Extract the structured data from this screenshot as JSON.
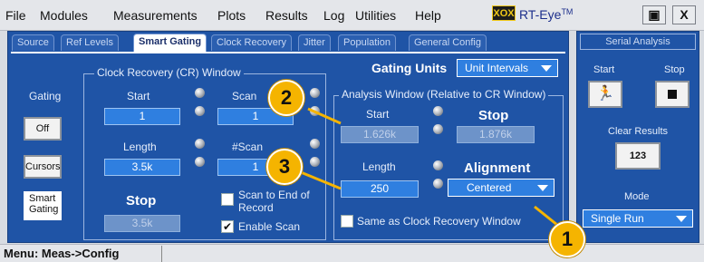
{
  "menu": {
    "items": [
      "File",
      "Modules",
      "Measurements",
      "Plots",
      "Results",
      "Log",
      "Utilities",
      "Help"
    ],
    "brand_logo": "XOX",
    "brand_name": "RT-Eye",
    "brand_tm": "TM",
    "restore_glyph": "▣",
    "close_glyph": "X"
  },
  "tabs": [
    "Source",
    "Ref Levels",
    "Smart Gating",
    "Clock Recovery",
    "Jitter",
    "Population",
    "General Config"
  ],
  "active_tab": "Smart Gating",
  "gating": {
    "label": "Gating",
    "off_button": "Off",
    "cursors_button": "Cursors",
    "smart_gating_button": "Smart Gating"
  },
  "cr_window": {
    "title": "Clock Recovery (CR) Window",
    "start_label": "Start",
    "start_value": "1",
    "length_label": "Length",
    "length_value": "3.5k",
    "stop_label": "Stop",
    "stop_value": "3.5k",
    "scan_label": "Scan",
    "scan_value": "1",
    "nscans_label": "#Scan",
    "nscans_value": "1",
    "scan_to_end_label": "Scan to End of Record",
    "enable_scan_label": "Enable Scan",
    "enable_scan_checked": "✔"
  },
  "gating_units": {
    "label": "Gating Units",
    "value": "Unit Intervals"
  },
  "analysis_window": {
    "title": "Analysis Window (Relative to CR Window)",
    "start_label": "Start",
    "start_value": "1.626k",
    "stop_label": "Stop",
    "stop_value": "1.876k",
    "length_label": "Length",
    "length_value": "250",
    "alignment_label": "Alignment",
    "alignment_value": "Centered",
    "same_as_label": "Same as Clock Recovery Window"
  },
  "side_panel": {
    "header": "Serial Analysis",
    "start_label": "Start",
    "stop_label": "Stop",
    "clear_results_label": "Clear Results",
    "clear_results_icon_text": "123",
    "mode_label": "Mode",
    "mode_value": "Single Run"
  },
  "status": {
    "text": "Menu: Meas->Config"
  },
  "callouts": [
    "1",
    "2",
    "3"
  ],
  "colors": {
    "panel_blue": "#1f54a6",
    "field_blue": "#2f7fe0",
    "callout_yellow": "#f5b400"
  }
}
